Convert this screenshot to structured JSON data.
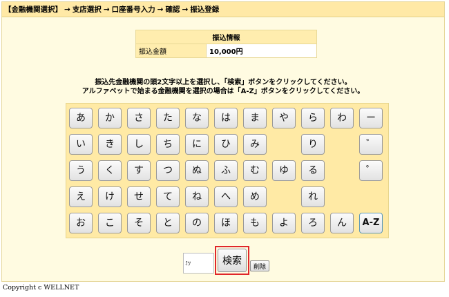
{
  "breadcrumb": {
    "current": "【金融機関選択】",
    "steps": [
      "支店選択",
      "口座番号入力",
      "確認",
      "振込登録"
    ],
    "arrow": "→"
  },
  "transfer_info": {
    "title": "振込情報",
    "amount_label": "振込金額",
    "amount_value": "10,000円"
  },
  "instructions": {
    "line1": "振込先金融機関の頭2文字以上を選択し、「検索」ボタンをクリックしてください。",
    "line2": "アルファベットで始まる金融機関を選択の場合は「A-Z」ボタンをクリックしてください。"
  },
  "kana_keys": [
    {
      "label": "あ"
    },
    {
      "label": "か"
    },
    {
      "label": "さ"
    },
    {
      "label": "た"
    },
    {
      "label": "な"
    },
    {
      "label": "は"
    },
    {
      "label": "ま"
    },
    {
      "label": "や"
    },
    {
      "label": "ら"
    },
    {
      "label": "わ"
    },
    {
      "label": "ー"
    },
    {
      "label": "い"
    },
    {
      "label": "き"
    },
    {
      "label": "し"
    },
    {
      "label": "ち"
    },
    {
      "label": "に"
    },
    {
      "label": "ひ"
    },
    {
      "label": "み"
    },
    {
      "label": "り"
    },
    {
      "label": "゛"
    },
    {
      "label": "う"
    },
    {
      "label": "く"
    },
    {
      "label": "す"
    },
    {
      "label": "つ"
    },
    {
      "label": "ぬ"
    },
    {
      "label": "ふ"
    },
    {
      "label": "む"
    },
    {
      "label": "ゆ"
    },
    {
      "label": "る"
    },
    {
      "label": "゜"
    },
    {
      "label": "え"
    },
    {
      "label": "け"
    },
    {
      "label": "せ"
    },
    {
      "label": "て"
    },
    {
      "label": "ね"
    },
    {
      "label": "へ"
    },
    {
      "label": "め"
    },
    {
      "label": "れ"
    },
    {
      "label": "お"
    },
    {
      "label": "こ"
    },
    {
      "label": "そ"
    },
    {
      "label": "と"
    },
    {
      "label": "の"
    },
    {
      "label": "ほ"
    },
    {
      "label": "も"
    },
    {
      "label": "よ"
    },
    {
      "label": "ろ"
    },
    {
      "label": "ん"
    },
    {
      "label": "A-Z"
    }
  ],
  "search": {
    "input_value": "ﾐﾂ",
    "search_label": "検索",
    "delete_label": "削除"
  },
  "footer": {
    "copyright": "Copyright c WELLNET"
  },
  "colors": {
    "background": "#fffbe1",
    "header": "#ffe9a6",
    "panel": "#ffeaa5",
    "highlight": "#e0262a"
  }
}
